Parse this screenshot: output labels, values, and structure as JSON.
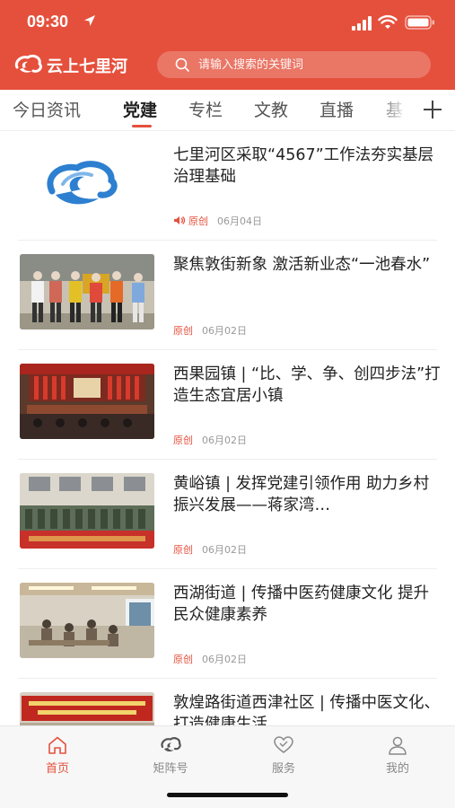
{
  "status_bar": {
    "time": "09:30"
  },
  "header": {
    "app_name": "云上七里河",
    "search_placeholder": "请输入搜索的关键词"
  },
  "tabs": [
    {
      "label": "今日资讯",
      "active": false
    },
    {
      "label": "党建",
      "active": true
    },
    {
      "label": "专栏",
      "active": false
    },
    {
      "label": "文教",
      "active": false
    },
    {
      "label": "直播",
      "active": false
    },
    {
      "label": "基",
      "active": false
    }
  ],
  "articles": [
    {
      "title": "七里河区采取“4567”工作法夯实基层治理基础",
      "tag": "原创",
      "date": "06月04日",
      "has_audio": true,
      "thumb": "logo"
    },
    {
      "title": "聚焦敦街新象 激活新业态“一池春水”",
      "tag": "原创",
      "date": "06月02日",
      "has_audio": false,
      "thumb": "group-photo"
    },
    {
      "title": "西果园镇 | “比、学、争、创四步法”打造生态宜居小镇",
      "tag": "原创",
      "date": "06月02日",
      "has_audio": false,
      "thumb": "meeting-hall"
    },
    {
      "title": "黄峪镇 | 发挥党建引领作用 助力乡村振兴发展——蒋家湾…",
      "tag": "原创",
      "date": "06月02日",
      "has_audio": false,
      "thumb": "outdoor-assembly"
    },
    {
      "title": "西湖街道 | 传播中医药健康文化 提升民众健康素养",
      "tag": "原创",
      "date": "06月02日",
      "has_audio": false,
      "thumb": "clinic-room"
    },
    {
      "title": "敦煌路街道西津社区 | 传播中医文化、打造健康生活",
      "tag": "",
      "date": "",
      "has_audio": false,
      "thumb": "banner-event"
    }
  ],
  "bottom_nav": [
    {
      "label": "首页",
      "icon": "home-icon",
      "active": true
    },
    {
      "label": "矩阵号",
      "icon": "matrix-logo-icon",
      "active": false
    },
    {
      "label": "服务",
      "icon": "service-heart-icon",
      "active": false
    },
    {
      "label": "我的",
      "icon": "profile-icon",
      "active": false
    }
  ],
  "colors": {
    "brand": "#e5503c",
    "text": "#222222",
    "muted": "#999999",
    "nav_bg": "#f7f7f7"
  }
}
